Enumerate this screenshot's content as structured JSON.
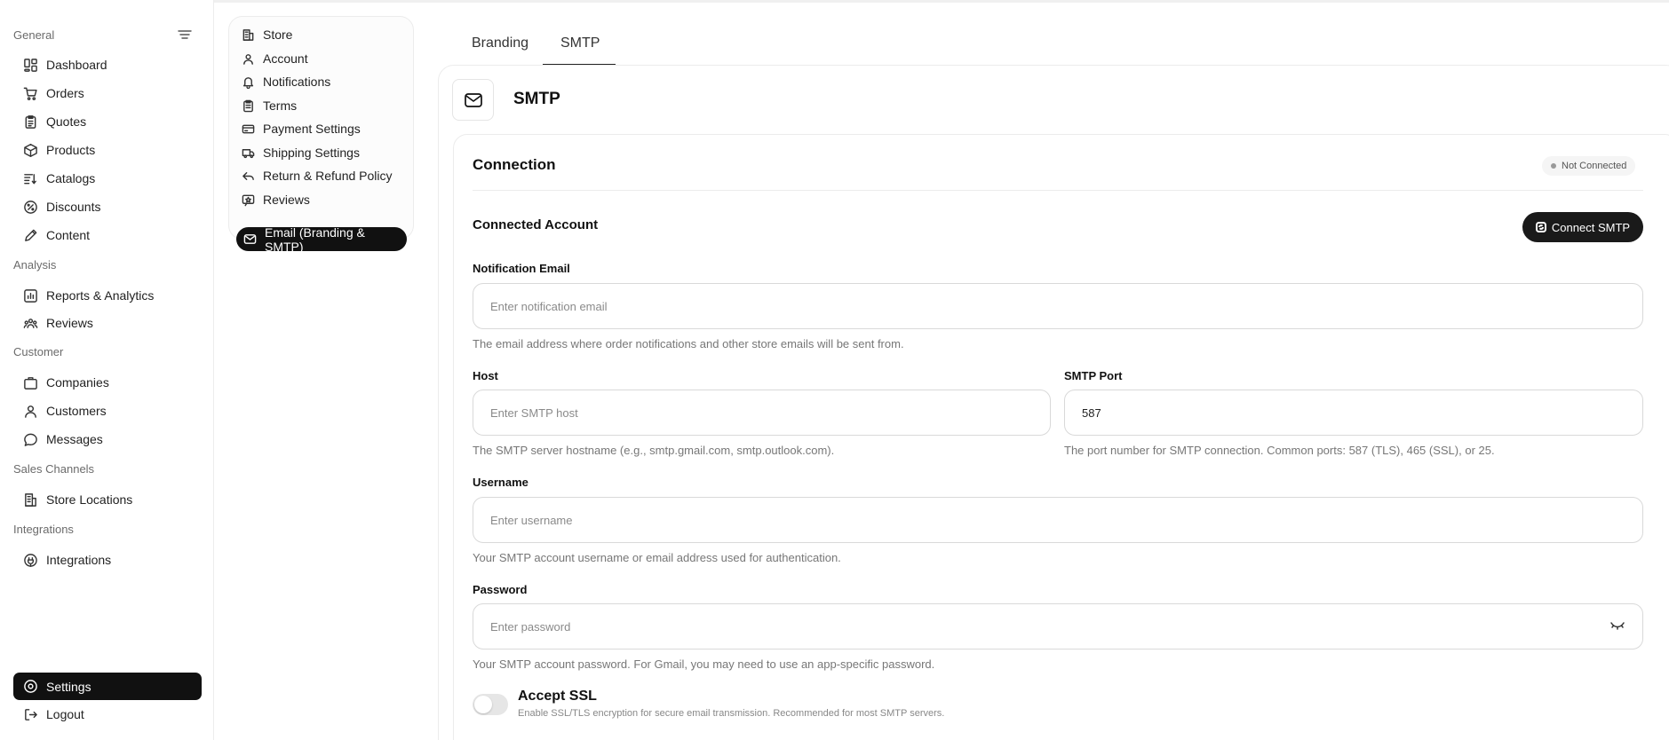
{
  "sidebar": {
    "groups": {
      "general": "General",
      "analysis": "Analysis",
      "customer": "Customer",
      "sales_channels": "Sales Channels",
      "integrations": "Integrations"
    },
    "items": {
      "dashboard": "Dashboard",
      "orders": "Orders",
      "quotes": "Quotes",
      "products": "Products",
      "catalogs": "Catalogs",
      "discounts": "Discounts",
      "content": "Content",
      "reports": "Reports & Analytics",
      "reviews": "Reviews",
      "companies": "Companies",
      "customers": "Customers",
      "messages": "Messages",
      "store_locations": "Store Locations",
      "integrations": "Integrations",
      "settings": "Settings",
      "logout": "Logout"
    }
  },
  "submenu": {
    "store": "Store",
    "account": "Account",
    "notifications": "Notifications",
    "terms": "Terms",
    "payment": "Payment Settings",
    "shipping": "Shipping Settings",
    "refund": "Return & Refund Policy",
    "reviews": "Reviews",
    "email": "Email (Branding & SMTP)"
  },
  "tabs": {
    "branding": "Branding",
    "smtp": "SMTP",
    "active": "SMTP"
  },
  "main": {
    "title": "SMTP",
    "connection_title": "Connection",
    "status": "Not Connected",
    "connected_account": "Connected Account",
    "connect_button": "Connect SMTP"
  },
  "form": {
    "notification_email": {
      "label": "Notification Email",
      "placeholder": "Enter notification email",
      "value": "",
      "help": "The email address where order notifications and other store emails will be sent from."
    },
    "host": {
      "label": "Host",
      "placeholder": "Enter SMTP host",
      "value": "",
      "help": "The SMTP server hostname (e.g., smtp.gmail.com, smtp.outlook.com)."
    },
    "port": {
      "label": "SMTP Port",
      "value": "587",
      "help": "The port number for SMTP connection. Common ports: 587 (TLS), 465 (SSL), or 25."
    },
    "username": {
      "label": "Username",
      "placeholder": "Enter username",
      "value": "",
      "help": "Your SMTP account username or email address used for authentication."
    },
    "password": {
      "label": "Password",
      "placeholder": "Enter password",
      "value": "",
      "help": "Your SMTP account password. For Gmail, you may need to use an app-specific password."
    },
    "ssl": {
      "label": "Accept SSL",
      "help": "Enable SSL/TLS encryption for secure email transmission. Recommended for most SMTP servers.",
      "enabled": false
    }
  },
  "icons": {
    "sidebar_toggle": "sidebar-toggle-icon",
    "mail": "mail-icon",
    "eye": "eye-closed-icon"
  }
}
